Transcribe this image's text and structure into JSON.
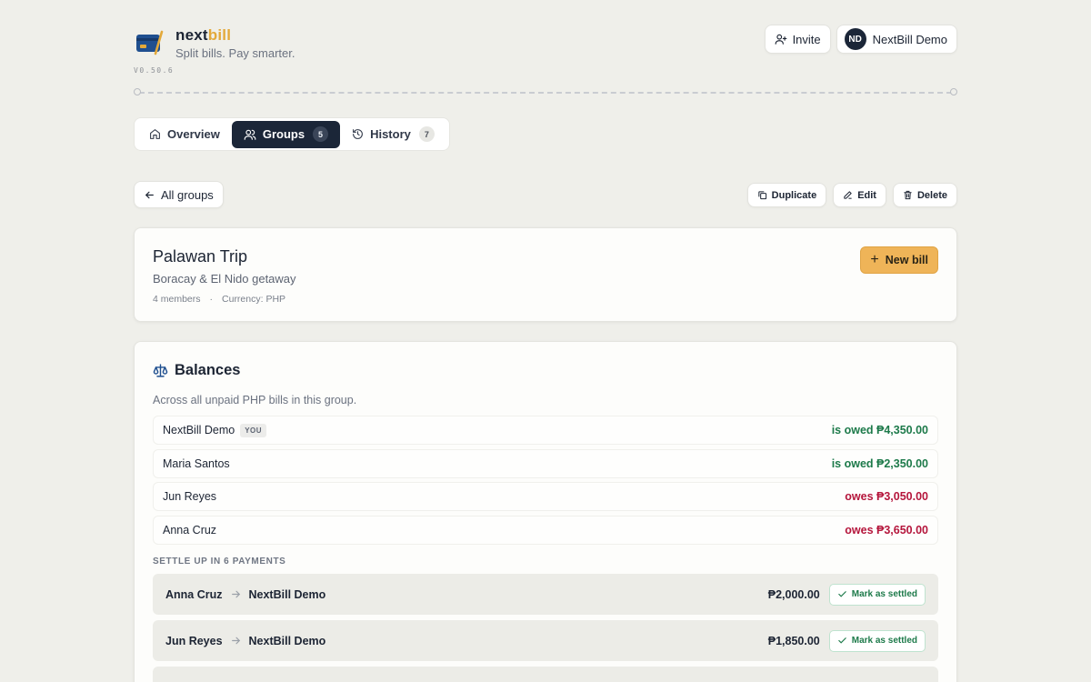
{
  "brand": {
    "name_part1": "next",
    "name_part2": "bill",
    "tagline": "Split bills. Pay smarter.",
    "version": "V0.50.6"
  },
  "header": {
    "invite_label": "Invite",
    "user_initials": "ND",
    "user_name": "NextBill Demo"
  },
  "tabs": [
    {
      "label": "Overview",
      "icon": "home-icon"
    },
    {
      "label": "Groups",
      "icon": "users-icon",
      "count": "5",
      "active": true
    },
    {
      "label": "History",
      "icon": "history-icon",
      "count": "7"
    }
  ],
  "nav": {
    "back_label": "All groups"
  },
  "actions": {
    "duplicate": "Duplicate",
    "edit": "Edit",
    "delete": "Delete"
  },
  "group": {
    "title": "Palawan Trip",
    "subtitle": "Boracay & El Nido getaway",
    "members": "4 members",
    "separator": "·",
    "currency": "Currency: PHP",
    "new_bill_label": "New bill"
  },
  "balances": {
    "title": "Balances",
    "description": "Across all unpaid PHP bills in this group.",
    "you_badge": "YOU",
    "rows": [
      {
        "name": "NextBill Demo",
        "status": "is owed ₱4,350.00",
        "type": "owed",
        "you": true
      },
      {
        "name": "Maria Santos",
        "status": "is owed ₱2,350.00",
        "type": "owed"
      },
      {
        "name": "Jun Reyes",
        "status": "owes ₱3,050.00",
        "type": "owes"
      },
      {
        "name": "Anna Cruz",
        "status": "owes ₱3,650.00",
        "type": "owes"
      }
    ]
  },
  "settle": {
    "heading": "SETTLE UP IN 6 PAYMENTS",
    "mark_label": "Mark as settled",
    "payments": [
      {
        "from": "Anna Cruz",
        "to": "NextBill Demo",
        "amount": "₱2,000.00"
      },
      {
        "from": "Jun Reyes",
        "to": "NextBill Demo",
        "amount": "₱1,850.00"
      }
    ]
  },
  "colors": {
    "accent": "#efb458",
    "dark": "#1b2638",
    "owed": "#1d7a4a",
    "owes": "#b5163c",
    "background": "#efefea"
  }
}
